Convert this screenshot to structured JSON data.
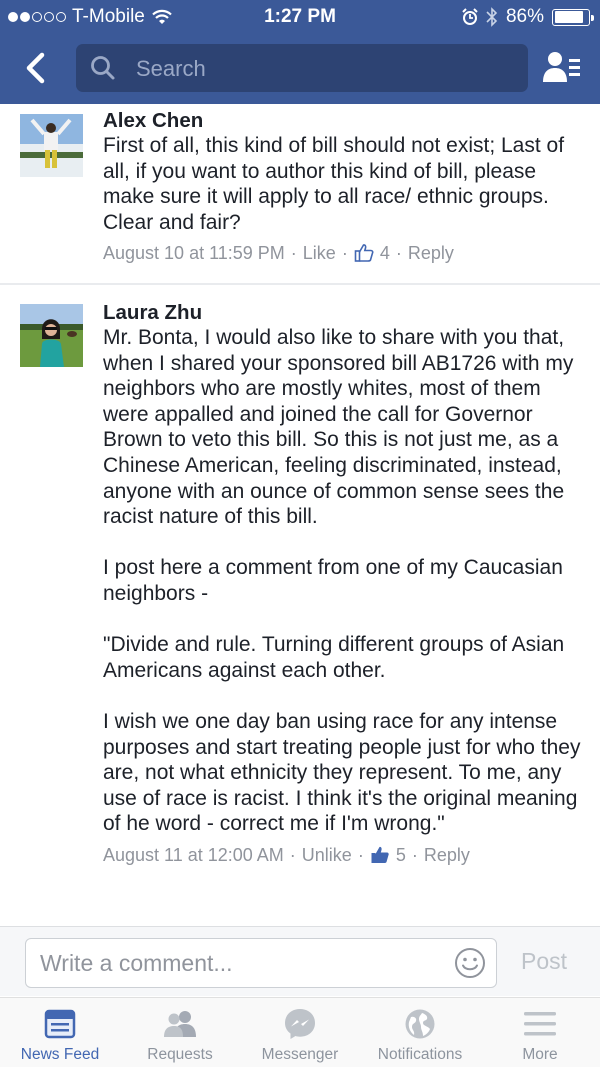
{
  "status_bar": {
    "carrier": "T-Mobile",
    "time": "1:27 PM",
    "battery": "86%",
    "battery_level": 0.86
  },
  "header": {
    "search_placeholder": "Search"
  },
  "comments": [
    {
      "author": "Alex Chen",
      "text": "First of all, this kind of bill should not exist; Last of all, if you want to author this kind of bill, please make sure it will apply to all race/ ethnic groups. Clear and fair?",
      "timestamp": "August 10 at 11:59 PM",
      "like_label": "Like",
      "like_count": "4",
      "reply_label": "Reply"
    },
    {
      "author": "Laura Zhu",
      "text": "Mr. Bonta, I would also like to share with you that, when I shared your sponsored bill AB1726 with my neighbors who are mostly whites, most of them were appalled and joined the call for Governor Brown to veto this bill. So this is not just me, as a Chinese American, feeling discriminated, instead, anyone with an ounce of common sense sees the racist nature of this bill.\n\nI post here a comment from one of my Caucasian neighbors -\n\n\"Divide and rule.  Turning different groups of Asian Americans against each other.\n\nI wish we one day ban using race for any intense purposes and start treating people just for who they are, not what ethnicity they represent.  To me, any use of race is racist.  I think it's the original meaning of he word - correct me if I'm wrong.\"",
      "timestamp": "August 11 at 12:00 AM",
      "like_label": "Unlike",
      "like_count": "5",
      "reply_label": "Reply"
    }
  ],
  "composer": {
    "placeholder": "Write a comment...",
    "post_label": "Post"
  },
  "tabs": [
    {
      "label": "News Feed",
      "icon": "news-feed-icon",
      "active": true
    },
    {
      "label": "Requests",
      "icon": "friends-icon",
      "active": false
    },
    {
      "label": "Messenger",
      "icon": "messenger-icon",
      "active": false
    },
    {
      "label": "Notifications",
      "icon": "globe-icon",
      "active": false
    },
    {
      "label": "More",
      "icon": "menu-icon",
      "active": false
    }
  ],
  "colors": {
    "brand_blue": "#3b5998",
    "link_blue": "#4267b2",
    "meta_gray": "#90949c"
  }
}
